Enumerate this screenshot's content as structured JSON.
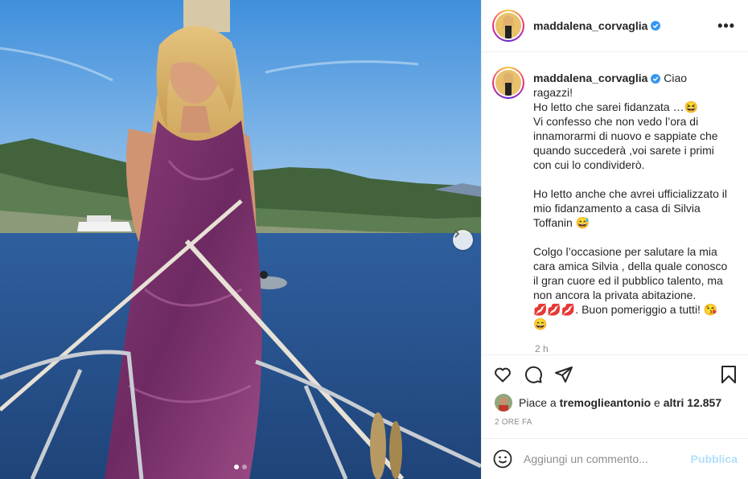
{
  "header": {
    "username": "maddalena_corvaglia",
    "more_label": "•••"
  },
  "caption": {
    "username": "maddalena_corvaglia",
    "line1": "Ciao ragazzi!",
    "line2": "Ho letto che sarei fidanzata …😆",
    "para1": "Vi confesso che non vedo l’ora di innamorarmi di nuovo e sappiate che quando succederà ,voi sarete i primi con cui lo condividerò.",
    "para2": "Ho letto anche che avrei ufficializzato il mio fidanzamento a casa di Silvia Toffanin 😅",
    "para3": "Colgo l’occasione per salutare la mia cara amica Silvia , della quale conosco il gran cuore ed il pubblico talento, ma non ancora la privata abitazione.",
    "para4": "💋💋💋. Buon pomeriggio a tutti! 😘😄",
    "time": "2 h"
  },
  "likes": {
    "prefix": "Piace a",
    "user": "tremoglieantonio",
    "middle": "e",
    "others": "altri 12.857"
  },
  "date": "2 ORE FA",
  "comment_input": {
    "placeholder": "Aggiungi un commento...",
    "publish_label": "Pubblica"
  },
  "carousel": {
    "slides": 2,
    "active": 1
  },
  "icons": [
    "verified-icon",
    "heart-icon",
    "comment-icon",
    "share-icon",
    "bookmark-icon",
    "emoji-icon",
    "chevron-right-icon"
  ],
  "colors": {
    "verified": "#3897f0",
    "publish_disabled": "#b2dffc",
    "muted": "#8e8e8e"
  }
}
